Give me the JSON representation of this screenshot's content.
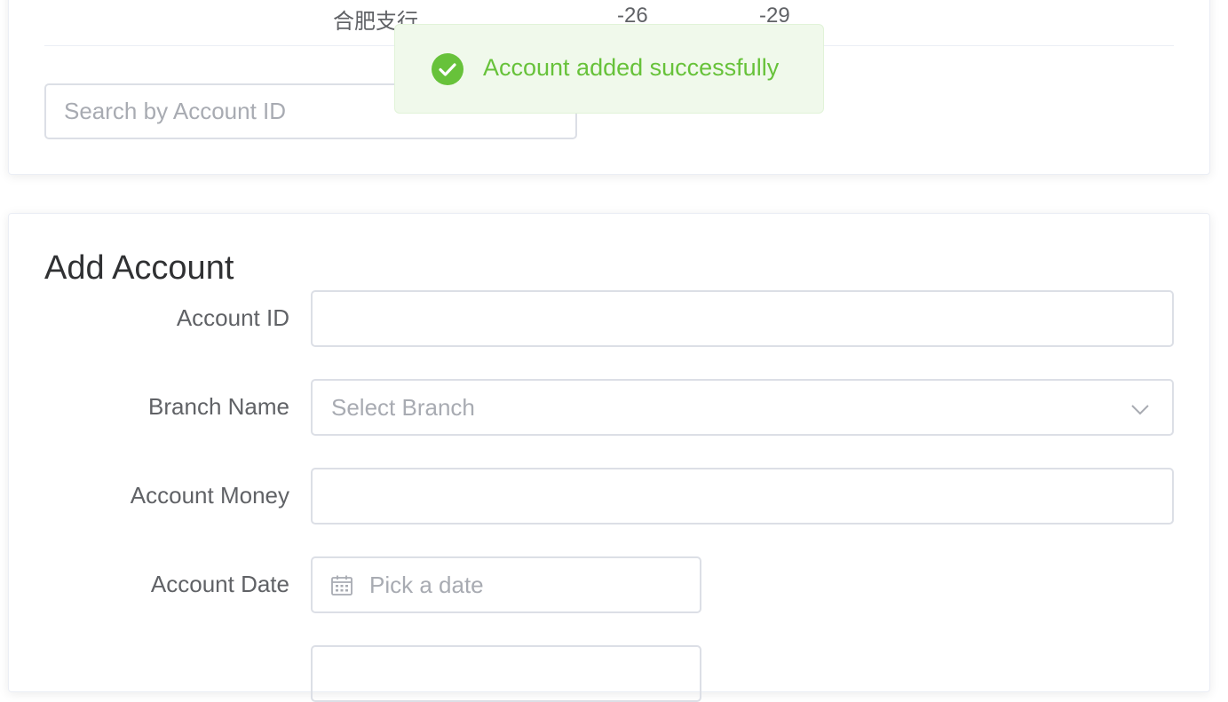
{
  "table": {
    "last_row": {
      "branch": "合肥支行",
      "value_1": "-26",
      "value_2": "-29"
    }
  },
  "search": {
    "placeholder": "Search by Account ID"
  },
  "toast": {
    "message": "Account added successfully",
    "type": "success",
    "icon": "check-circle-icon",
    "color": "#67c23a"
  },
  "add_account": {
    "title": "Add Account",
    "fields": {
      "account_id": {
        "label": "Account ID",
        "value": ""
      },
      "branch_name": {
        "label": "Branch Name",
        "placeholder": "Select Branch"
      },
      "account_money": {
        "label": "Account Money",
        "value": ""
      },
      "account_date": {
        "label": "Account Date",
        "placeholder": "Pick a date"
      }
    }
  },
  "colors": {
    "border": "#dcdfe6",
    "placeholder": "#a8abb2",
    "label": "#606266",
    "success": "#67c23a",
    "success_bg": "#f0f9eb"
  }
}
